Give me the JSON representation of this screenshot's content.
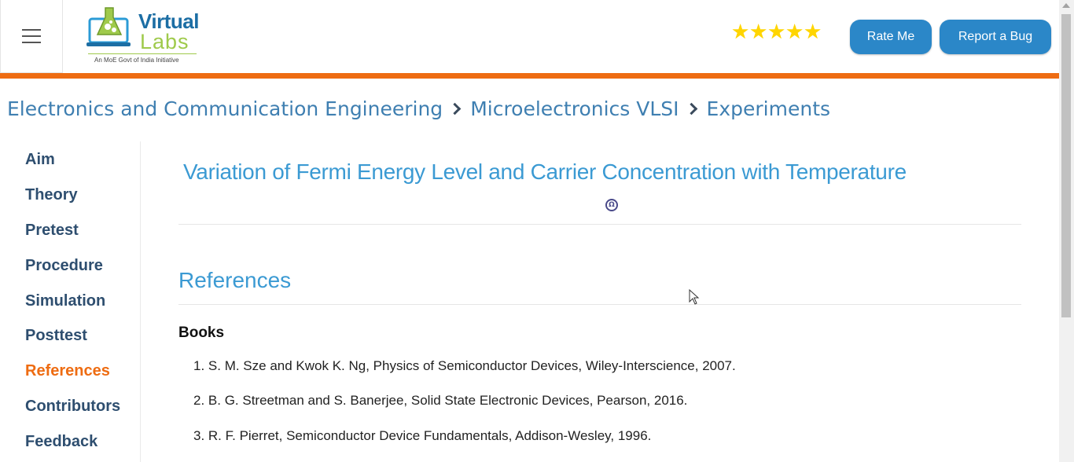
{
  "header": {
    "menu_icon": "hamburger-menu-icon",
    "logo": {
      "line1": "Virtual",
      "line2": "Labs",
      "tagline": "An MoE Govt of India Initiative"
    },
    "rating_stars": 5,
    "star_glyph": "★",
    "rate_label": "Rate Me",
    "bug_label": "Report a Bug"
  },
  "colors": {
    "accent": "#2b87c8",
    "orange": "#ee6c12",
    "title_blue": "#3b9ad3",
    "star": "#ffd500"
  },
  "breadcrumb": {
    "items": [
      "Electronics and Communication Engineering",
      "Microelectronics VLSI",
      "Experiments"
    ]
  },
  "sidebar": {
    "items": [
      {
        "label": "Aim",
        "active": false
      },
      {
        "label": "Theory",
        "active": false
      },
      {
        "label": "Pretest",
        "active": false
      },
      {
        "label": "Procedure",
        "active": false
      },
      {
        "label": "Simulation",
        "active": false
      },
      {
        "label": "Posttest",
        "active": false
      },
      {
        "label": "References",
        "active": true
      },
      {
        "label": "Contributors",
        "active": false
      },
      {
        "label": "Feedback",
        "active": false
      }
    ]
  },
  "main": {
    "experiment_title": "Variation of Fermi Energy Level and Carrier Concentration with Temperature",
    "institute_icon": "institute-logo-icon",
    "section_title": "References",
    "books_heading": "Books",
    "references": [
      "S. M. Sze and Kwok K. Ng, Physics of Semiconductor Devices, Wiley-Interscience, 2007.",
      "B. G. Streetman and S. Banerjee, Solid State Electronic Devices, Pearson, 2016.",
      "R. F. Pierret, Semiconductor Device Fundamentals, Addison-Wesley, 1996."
    ]
  }
}
